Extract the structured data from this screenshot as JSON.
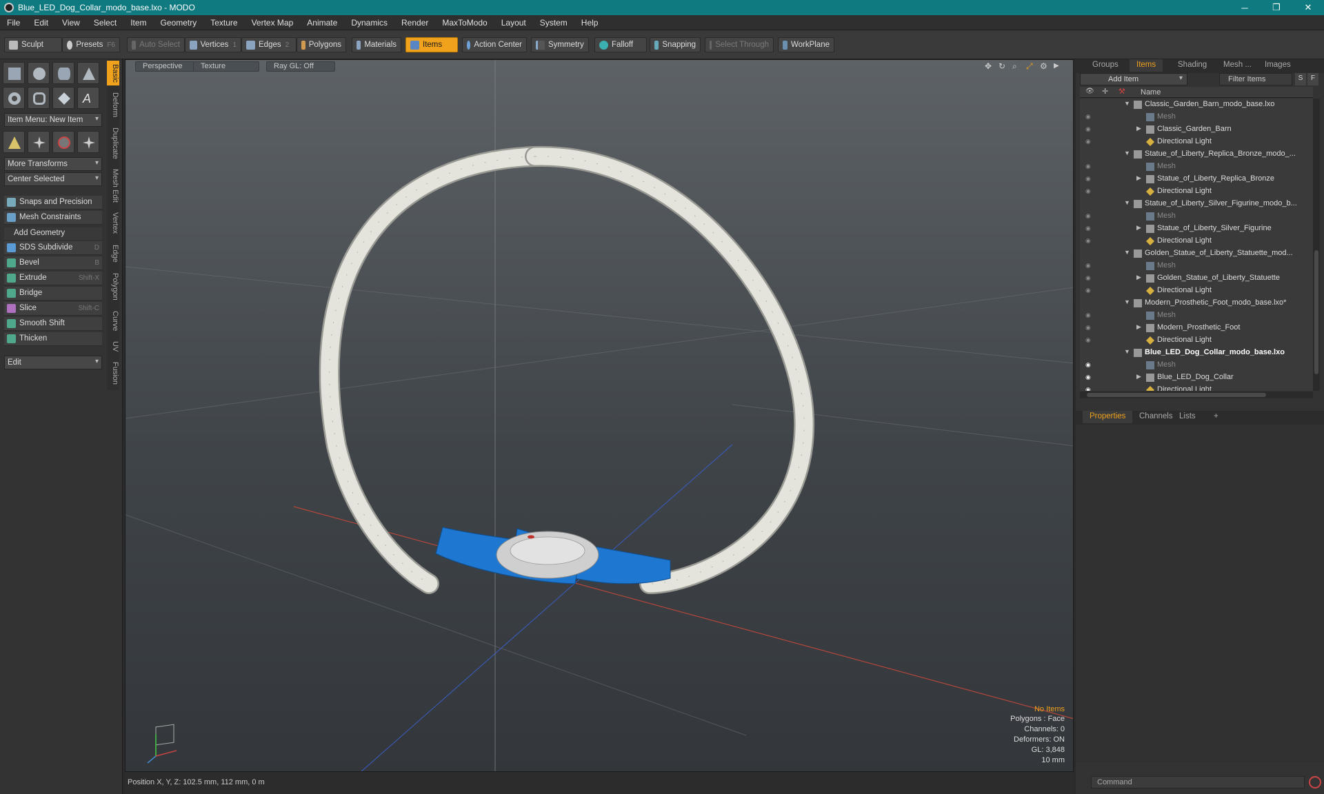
{
  "window": {
    "title": "Blue_LED_Dog_Collar_modo_base.lxo - MODO",
    "minimize": "─",
    "maximize": "❐",
    "close": "✕"
  },
  "menu": [
    "File",
    "Edit",
    "View",
    "Select",
    "Item",
    "Geometry",
    "Texture",
    "Vertex Map",
    "Animate",
    "Dynamics",
    "Render",
    "MaxToModo",
    "Layout",
    "System",
    "Help"
  ],
  "toolbar": {
    "sculpt": "Sculpt",
    "presets": "Presets",
    "presets_key": "F6",
    "auto_select": "Auto Select",
    "vertices": "Vertices",
    "vertices_key": "1",
    "edges": "Edges",
    "edges_key": "2",
    "polygons": "Polygons",
    "materials": "Materials",
    "items": "Items",
    "action_center": "Action Center",
    "symmetry": "Symmetry",
    "falloff": "Falloff",
    "snapping": "Snapping",
    "select_through": "Select Through",
    "workplane": "WorkPlane"
  },
  "left": {
    "item_menu": "Item Menu: New Item",
    "more_transforms": "More Transforms",
    "center_selected": "Center Selected",
    "snaps": "Snaps and Precision",
    "mesh_constraints": "Mesh Constraints",
    "add_geometry": "Add Geometry",
    "tools": [
      {
        "label": "SDS Subdivide",
        "key": "D"
      },
      {
        "label": "Bevel",
        "key": "B"
      },
      {
        "label": "Extrude",
        "key": "Shift-X"
      },
      {
        "label": "Bridge",
        "key": ""
      },
      {
        "label": "Slice",
        "key": "Shift-C"
      },
      {
        "label": "Smooth Shift",
        "key": ""
      },
      {
        "label": "Thicken",
        "key": ""
      }
    ],
    "edit": "Edit",
    "vtabs": [
      "Basic",
      "Deform",
      "Duplicate",
      "Mesh Edit",
      "Vertex",
      "Edge",
      "Polygon",
      "Curve",
      "UV",
      "Fusion"
    ]
  },
  "viewport": {
    "perspective": "Perspective",
    "texture": "Texture",
    "raygl": "Ray GL: Off",
    "info": {
      "no_items": "No Items",
      "polygons": "Polygons : Face",
      "channels": "Channels: 0",
      "deformers": "Deformers: ON",
      "gl": "GL: 3,848",
      "scale": "10 mm"
    },
    "colors": {
      "collar": "#e4e4dc",
      "led": "#1e78d2"
    }
  },
  "status": {
    "position": "Position X, Y, Z:   102.5 mm, 112 mm, 0 m"
  },
  "right": {
    "tabs": [
      "Groups",
      "Items",
      "Shading",
      "Mesh ...",
      "Images"
    ],
    "add_item": "Add Item",
    "filter_items": "Filter Items",
    "s": "S",
    "f": "F",
    "name_col": "Name",
    "tree": [
      {
        "name": "Classic_Garden_Barn_modo_base.lxo",
        "type": "scene"
      },
      {
        "name": "Mesh",
        "type": "mesh"
      },
      {
        "name": "Classic_Garden_Barn",
        "type": "item"
      },
      {
        "name": "Directional Light",
        "type": "light"
      },
      {
        "name": "Statue_of_Liberty_Replica_Bronze_modo_...",
        "type": "scene"
      },
      {
        "name": "Mesh",
        "type": "mesh"
      },
      {
        "name": "Statue_of_Liberty_Replica_Bronze",
        "type": "item"
      },
      {
        "name": "Directional Light",
        "type": "light"
      },
      {
        "name": "Statue_of_Liberty_Silver_Figurine_modo_b...",
        "type": "scene"
      },
      {
        "name": "Mesh",
        "type": "mesh"
      },
      {
        "name": "Statue_of_Liberty_Silver_Figurine",
        "type": "item"
      },
      {
        "name": "Directional Light",
        "type": "light"
      },
      {
        "name": "Golden_Statue_of_Liberty_Statuette_mod...",
        "type": "scene"
      },
      {
        "name": "Mesh",
        "type": "mesh"
      },
      {
        "name": "Golden_Statue_of_Liberty_Statuette",
        "type": "item"
      },
      {
        "name": "Directional Light",
        "type": "light"
      },
      {
        "name": "Modern_Prosthetic_Foot_modo_base.lxo*",
        "type": "scene"
      },
      {
        "name": "Mesh",
        "type": "mesh"
      },
      {
        "name": "Modern_Prosthetic_Foot",
        "type": "item"
      },
      {
        "name": "Directional Light",
        "type": "light"
      },
      {
        "name": "Blue_LED_Dog_Collar_modo_base.lxo",
        "type": "scene-bold"
      },
      {
        "name": "Mesh",
        "type": "mesh"
      },
      {
        "name": "Blue_LED_Dog_Collar",
        "type": "item"
      },
      {
        "name": "Directional Light",
        "type": "light"
      }
    ],
    "lower_tabs": [
      "Properties",
      "Channels",
      "Lists"
    ],
    "add_tab": "+",
    "command": "Command"
  }
}
